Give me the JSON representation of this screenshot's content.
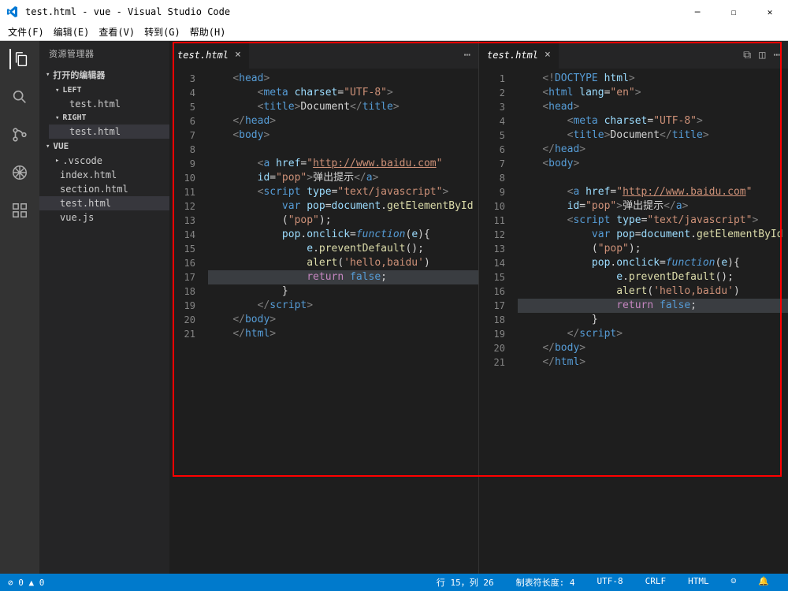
{
  "window": {
    "title": "test.html - vue - Visual Studio Code"
  },
  "menu": [
    "文件(F)",
    "编辑(E)",
    "查看(V)",
    "转到(G)",
    "帮助(H)"
  ],
  "sidebar": {
    "header": "资源管理器",
    "openEditors": "打开的编辑器",
    "groups": {
      "left": "LEFT",
      "right": "RIGHT",
      "leftFile": "test.html",
      "rightFile": "test.html"
    },
    "project": "VUE",
    "files": [
      ".vscode",
      "index.html",
      "section.html",
      "test.html",
      "vue.js"
    ]
  },
  "editor": {
    "leftTab": "test.html",
    "rightTab": "test.html",
    "leftStart": 3,
    "rightStart": 1
  },
  "code": {
    "url": "http://www.baidu.com",
    "popId": "pop",
    "popText": "弹出提示",
    "scriptType": "text/javascript",
    "alertMsg": "hello,baidu",
    "charset": "UTF-8",
    "lang": "en",
    "docTitle": "Document"
  },
  "statusbar": {
    "errors": "0",
    "warnings": "0",
    "position": "行 15，列 26",
    "tabsize": "制表符长度: 4",
    "encoding": "UTF-8",
    "eol": "CRLF",
    "lang": "HTML"
  }
}
